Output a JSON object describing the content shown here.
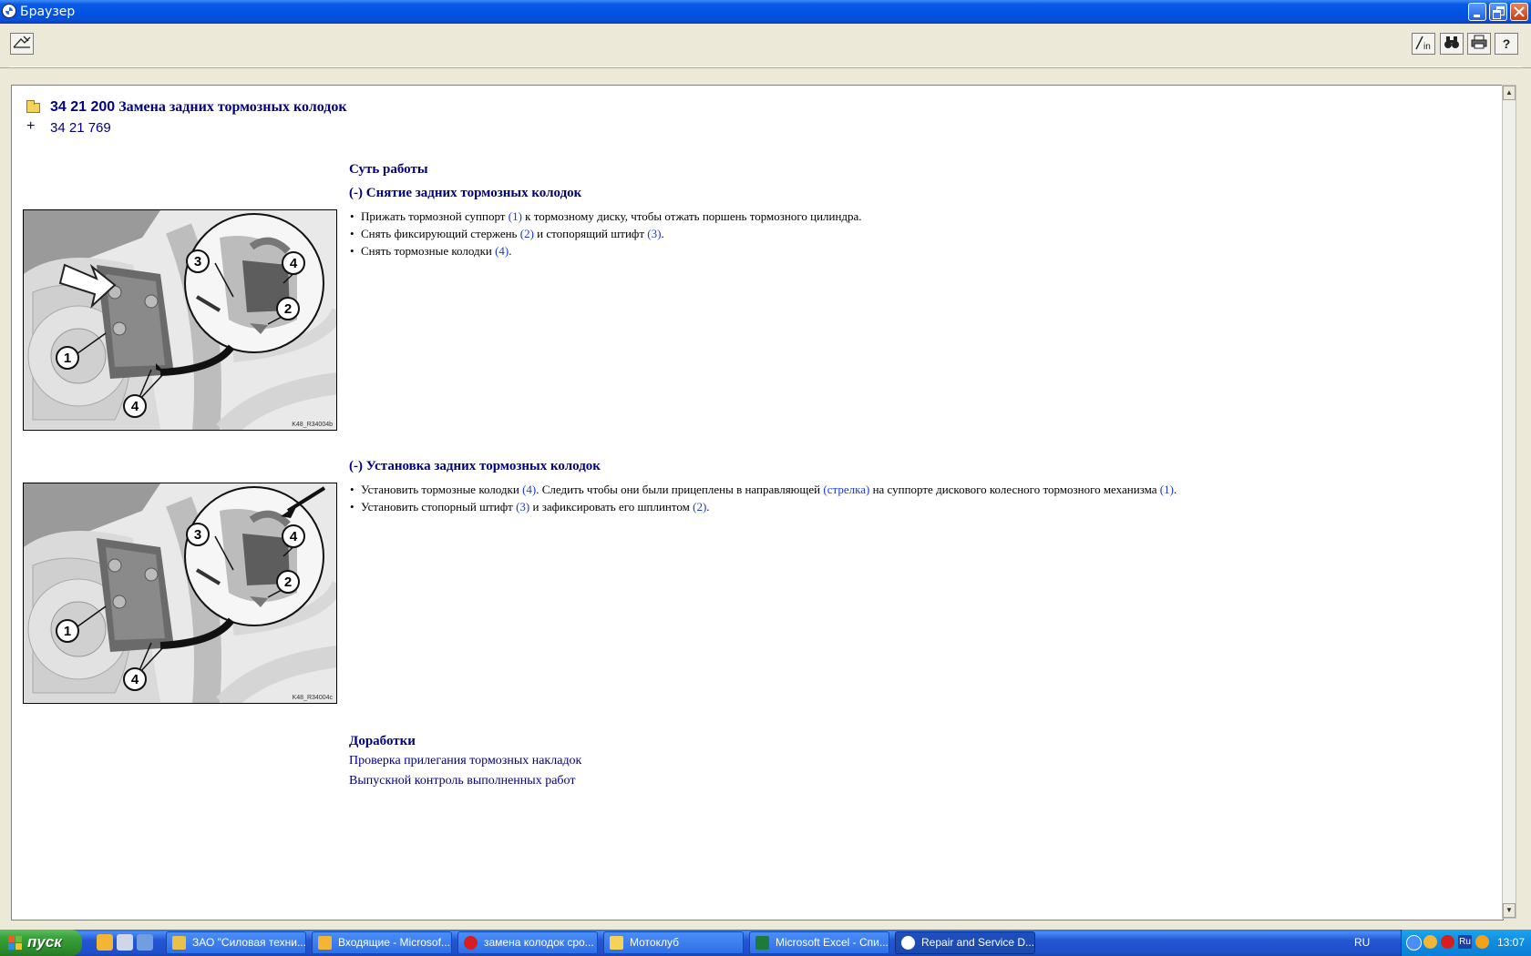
{
  "window": {
    "title": "Браузер"
  },
  "toolbar": {
    "left_icon": "image-edit-icon",
    "right_icons": [
      "insert-icon",
      "binoculars-icon",
      "printer-icon",
      "help-icon"
    ]
  },
  "document": {
    "breadcrumb_code": "34 21 200",
    "breadcrumb_title": "Замена задних тормозных колодок",
    "related_link": "34 21 769",
    "essence_heading": "Суть работы",
    "removal": {
      "heading": "(-) Снятие задних тормозных колодок",
      "figure_code": "K48_R34004b",
      "steps": [
        {
          "a": "Прижать тормозной суппорт ",
          "r1": "(1)",
          "b": " к тормозному диску, чтобы отжать поршень тормозного цилиндра.",
          "r2": "",
          "c": ""
        },
        {
          "a": "Снять фиксирующий стержень ",
          "r1": "(2)",
          "b": " и стопорящий штифт ",
          "r2": "(3)",
          "c": "."
        },
        {
          "a": "Снять тормозные колодки ",
          "r1": "(4)",
          "b": ".",
          "r2": "",
          "c": ""
        }
      ]
    },
    "installation": {
      "heading": "(-) Установка задних тормозных колодок",
      "figure_code": "K48_R34004c",
      "steps": [
        {
          "a": "Установить тормозные колодки ",
          "r1": "(4)",
          "b": ". Следить чтобы они были прицеплены в направляющей ",
          "r2": "(стрелка)",
          "c": " на суппорте дискового колесного тормозного механизма ",
          "r3": "(1)",
          "d": "."
        },
        {
          "a": "Установить стопорный штифт ",
          "r1": "(3)",
          "b": " и зафиксировать его шплинтом ",
          "r2": "(2)",
          "c": ".",
          "r3": "",
          "d": ""
        }
      ]
    },
    "followup_heading": "Доработки",
    "followup_links": [
      "Проверка прилегания тормозных накладок",
      "Выпускной контроль выполненных работ"
    ]
  },
  "figure_labels": [
    "1",
    "2",
    "3",
    "4",
    "4"
  ],
  "taskbar": {
    "start_label": "пуск",
    "tasks": [
      {
        "label": "ЗАО \"Силовая техни...",
        "icon": "browser-icon"
      },
      {
        "label": "Входящие - Microsof...",
        "icon": "outlook-icon"
      },
      {
        "label": "замена колодок сро...",
        "icon": "opera-icon"
      },
      {
        "label": "Мотоклуб",
        "icon": "folder-icon"
      },
      {
        "label": "Microsoft Excel - Спи...",
        "icon": "excel-icon"
      },
      {
        "label": "Repair and Service D...",
        "icon": "bmw-icon"
      }
    ],
    "language": "RU",
    "clock": "13:07"
  }
}
